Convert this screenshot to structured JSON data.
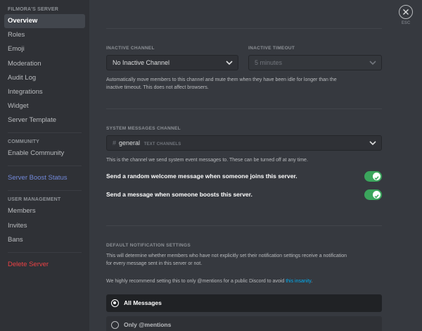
{
  "sidebar": {
    "section_server": "FILMORA'S SERVER",
    "items_server": [
      "Overview",
      "Roles",
      "Emoji",
      "Moderation",
      "Audit Log",
      "Integrations",
      "Widget",
      "Server Template"
    ],
    "section_community": "COMMUNITY",
    "enable_community": "Enable Community",
    "boost_status": "Server Boost Status",
    "section_user_management": "USER MANAGEMENT",
    "items_users": [
      "Members",
      "Invites",
      "Bans"
    ],
    "delete_server": "Delete Server"
  },
  "close": {
    "esc_label": "ESC",
    "icon": "close-icon"
  },
  "inactive": {
    "channel_label": "INACTIVE CHANNEL",
    "channel_value": "No Inactive Channel",
    "timeout_label": "INACTIVE TIMEOUT",
    "timeout_value": "5 minutes",
    "help_line1": "Automatically move members to this channel and mute them when they have been idle for longer than the",
    "help_line2": "inactive timeout. This does not affect browsers."
  },
  "system": {
    "label": "SYSTEM MESSAGES CHANNEL",
    "hash": "#",
    "channel_name": "general",
    "channel_type": "TEXT CHANNELS",
    "help": "This is the channel we send system event messages to. These can be turned off at any time.",
    "toggle_welcome_label": "Send a random welcome message when someone joins this server.",
    "toggle_welcome_on": true,
    "toggle_boost_label": "Send a message when someone boosts this server.",
    "toggle_boost_on": true
  },
  "notifications": {
    "label": "DEFAULT NOTIFICATION SETTINGS",
    "help_line1": "This will determine whether members who have not explicitly set their notification settings receive a notification",
    "help_line2": "for every message sent in this server or not.",
    "recommend_prefix": "We highly recommend setting this to only @mentions for a public Discord to avoid ",
    "recommend_link": "this insanity",
    "recommend_suffix": ".",
    "options": [
      "All Messages",
      "Only @mentions"
    ],
    "selected": "All Messages"
  },
  "colors": {
    "accent_green": "#3ba55c",
    "link_blue": "#00aff4",
    "boost_blue": "#7289da",
    "danger_red": "#ed4245"
  }
}
